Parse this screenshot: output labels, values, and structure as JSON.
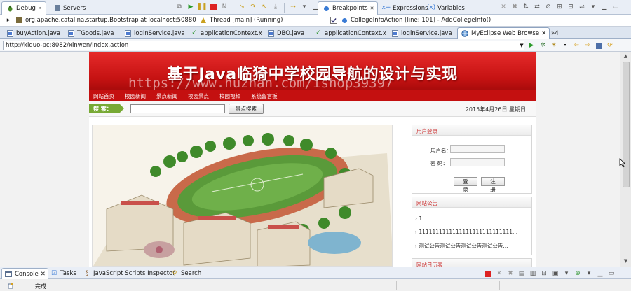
{
  "views": {
    "debug_tab": "Debug",
    "servers_tab": "Servers",
    "breakpoints_tab": "Breakpoints",
    "expressions_tab": "Expressions",
    "variables_tab": "Variables"
  },
  "debug_tree": {
    "process": "org.apache.catalina.startup.Bootstrap at localhost:50880",
    "thread": "Thread [main] (Running)"
  },
  "breakpoint": {
    "label": "CollegeInfoAction [line: 101] - AddCollegeInfo()",
    "checked": true
  },
  "editor_tabs": [
    {
      "label": "buyAction.java"
    },
    {
      "label": "TGoods.java"
    },
    {
      "label": "loginService.java"
    },
    {
      "label": "applicationContext.x"
    },
    {
      "label": "DBO.java"
    },
    {
      "label": "applicationContext.x"
    },
    {
      "label": "loginService.java"
    },
    {
      "label": "MyEclipse Web Browse"
    }
  ],
  "overflow_count": "»4",
  "browser": {
    "url": "http://kiduo-pc:8082/xinwen/index.action"
  },
  "site": {
    "title": "基于Java临猗中学校园导航的设计与实现",
    "watermark": "https://www.huzhan.com/ishop39397",
    "nav": [
      "网站首页",
      "校园新闻",
      "景点新闻",
      "校园景点",
      "校园视频",
      "系统留言板"
    ],
    "search_label": "搜 索：",
    "search_button": "景点搜索",
    "date": "2015年4月26日 星期日",
    "login": {
      "title": "用户登录",
      "username_label": "用户名：",
      "password_label": "密  码：",
      "login_button": "登 录",
      "register_button": "注 册"
    },
    "notice": {
      "title": "网站公告",
      "items": [
        "1...",
        "1111111111111111111111111111...",
        "测试公告测试公告测试公告测试公告..."
      ]
    },
    "calendar_title": "网站日历表"
  },
  "bottom": {
    "console_tab": "Console",
    "tasks_tab": "Tasks",
    "js_tab": "JavaScript Scripts Inspector",
    "search_tab": "Search"
  },
  "status": {
    "text": "完成"
  },
  "colors": {
    "banner_red": "#d41a1a",
    "nav_red": "#c41010",
    "search_green": "#77a934",
    "ide_blue": "#e9eef6"
  }
}
